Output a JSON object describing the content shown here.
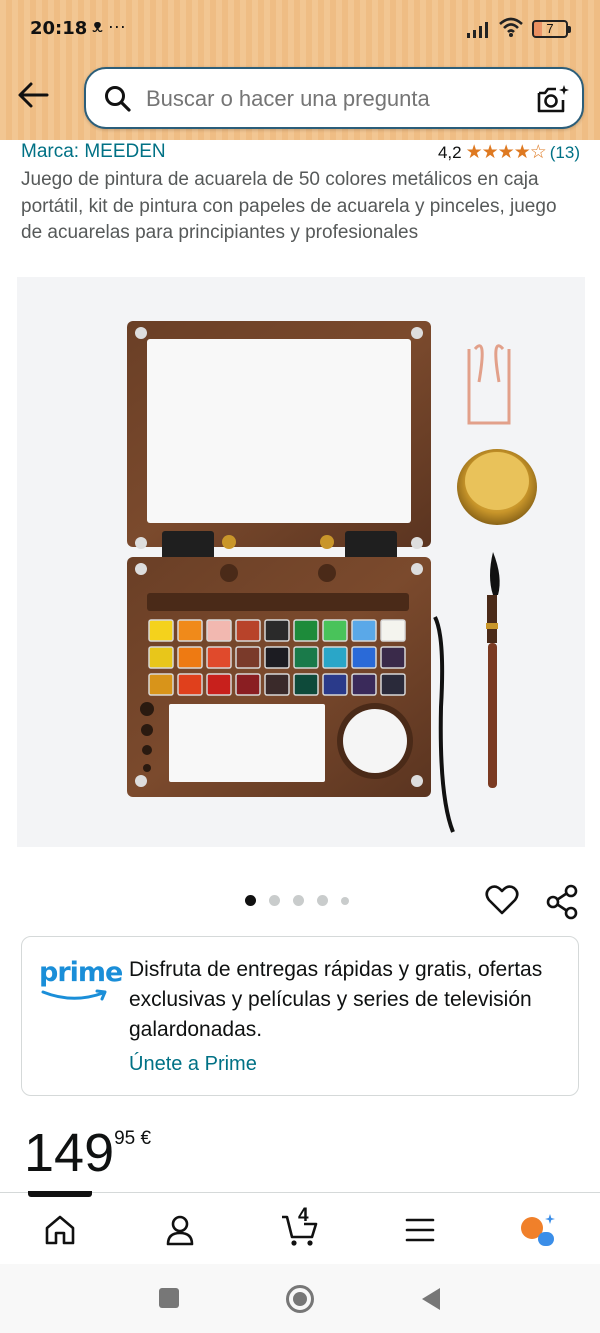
{
  "status_bar": {
    "time": "20:18",
    "icons": "ᴥ ···",
    "battery": "7"
  },
  "search": {
    "placeholder": "Buscar o hacer una pregunta"
  },
  "product": {
    "brand": "Marca: MEEDEN",
    "rating_value": "4,2",
    "rating_stars": "★★★★☆",
    "rating_count": "(13)",
    "title": "Juego de pintura de acuarela de 50 colores metálicos en caja portátil, kit de pintura con papeles de acuarela y pinceles, juego de acuarelas para principiantes y profesionales",
    "image_count": 5,
    "active_image": 1
  },
  "prime": {
    "logo": "prime",
    "text": "Disfruta de entregas rápidas y gratis, ofertas exclusivas y películas y series de televisión galardonadas.",
    "link": "Únete a Prime"
  },
  "price": {
    "whole": "149",
    "fraction": "95 €"
  },
  "bottom_nav": {
    "cart_count": "4",
    "items": [
      "home-icon",
      "account-icon",
      "cart-icon",
      "menu-icon",
      "assistant-icon"
    ]
  },
  "colors": {
    "header": "#f2c692",
    "link": "#007185",
    "star": "#de7921",
    "prime_blue": "#1a8ed8"
  },
  "paint_colors": [
    [
      "#f4d21c",
      "#f08a1a",
      "#f2b8b0",
      "#b8432a",
      "#2a2a2a",
      "#1d8b3a",
      "#49c35a",
      "#5aa8e8",
      "#f4f4ee"
    ],
    [
      "#e8c61a",
      "#ee7a12",
      "#e04a2c",
      "#7a3a2a",
      "#1c1c22",
      "#1a7a4a",
      "#2aa6c8",
      "#2a6ad8",
      "#3a2a4a"
    ],
    [
      "#d8941a",
      "#e0401c",
      "#c8201c",
      "#8a1e22",
      "#3a2a2a",
      "#0e4a3a",
      "#2a3a8a",
      "#3a2a5a",
      "#2a2a3a"
    ]
  ]
}
